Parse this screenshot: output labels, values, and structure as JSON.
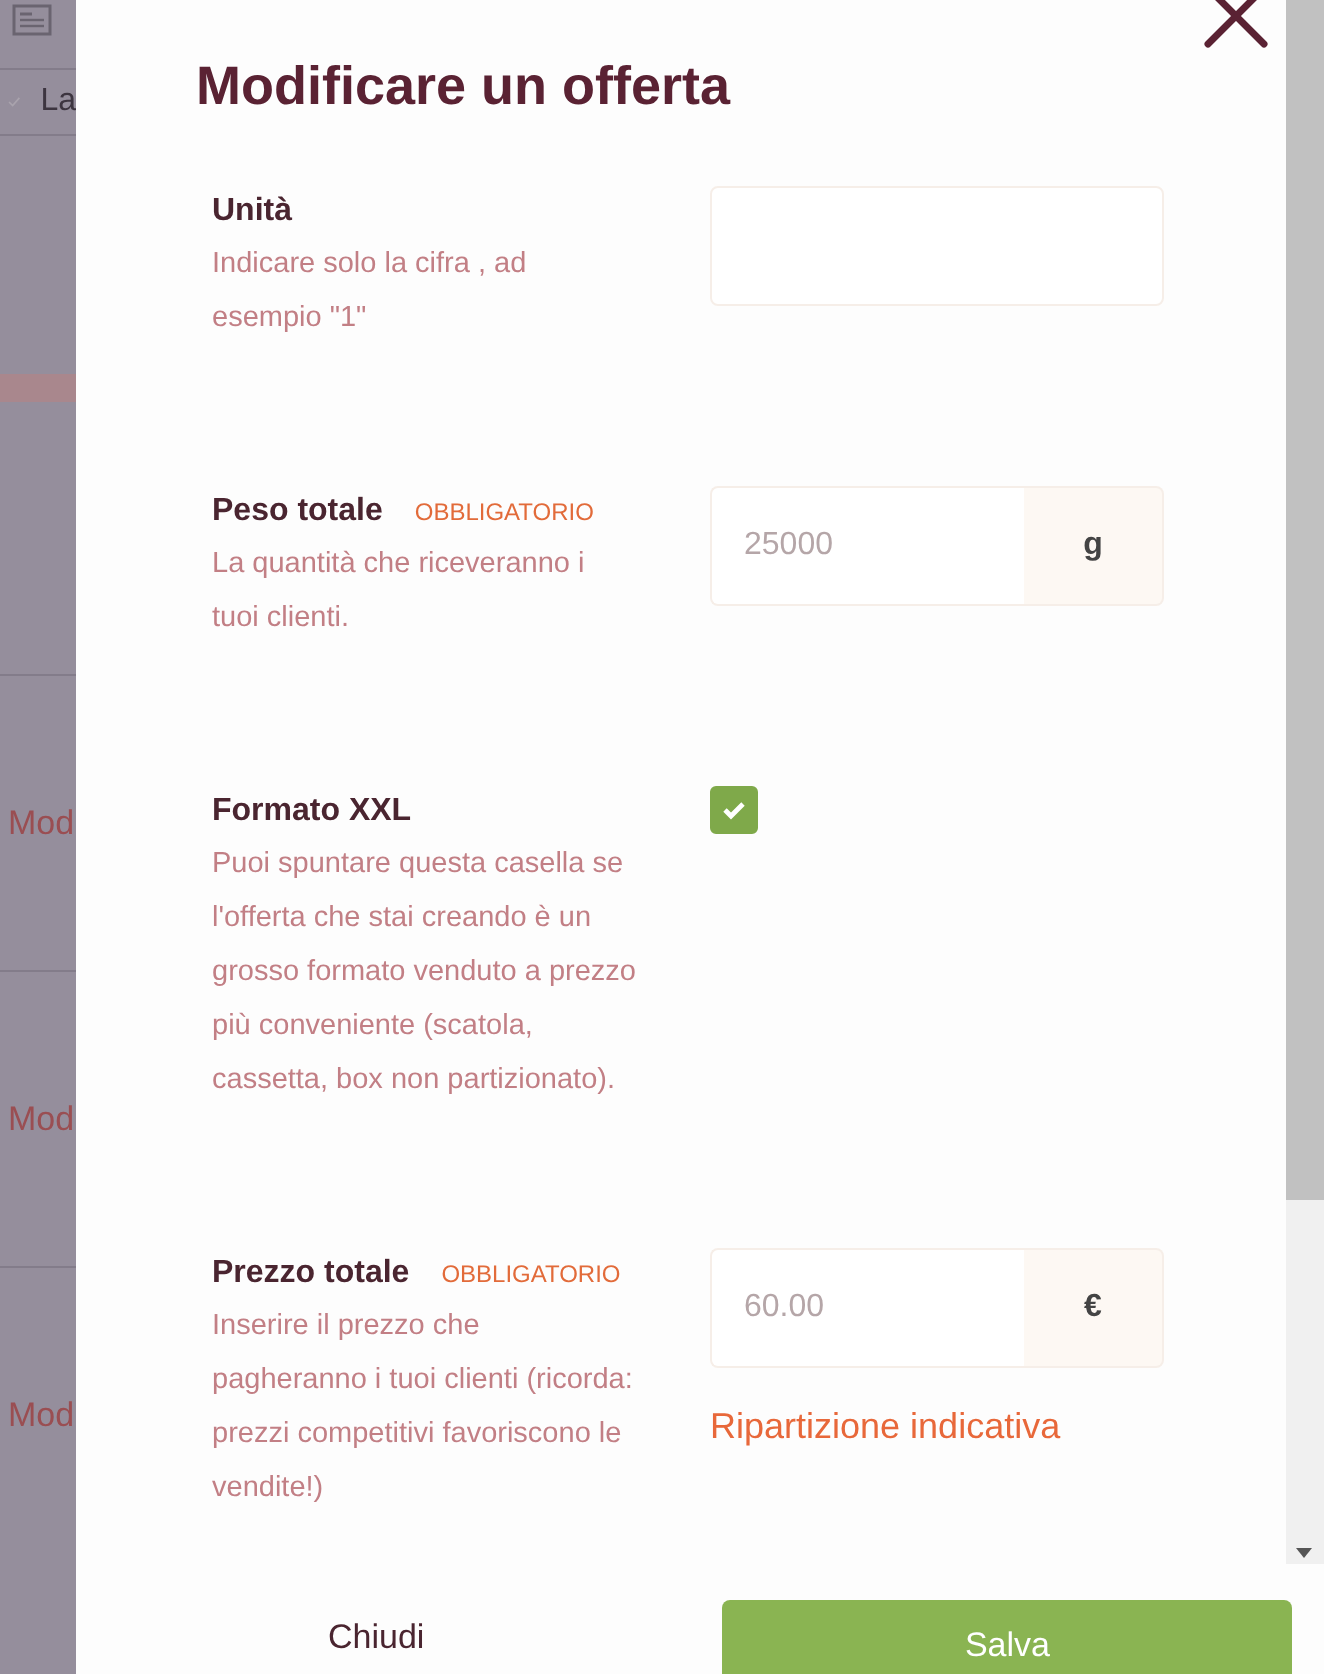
{
  "background": {
    "tab_label": "La",
    "items": [
      "Mod",
      "Mod",
      "Mod"
    ]
  },
  "dialog": {
    "title": "Modificare un offerta",
    "fields": [
      {
        "kind": "text",
        "label": "Unità",
        "description": "Indicare solo la cifra , ad esempio \"1\""
      },
      {
        "kind": "unit",
        "label": "Peso totale",
        "badge": "OBBLIGATORIO",
        "description": "La quantità che riceveranno i tuoi clienti.",
        "placeholder": "25000",
        "unit": "g"
      },
      {
        "kind": "checkbox",
        "label": "Formato XXL",
        "description": "Puoi spuntare questa casella se l'offerta che stai creando è un grosso formato venduto a prezzo più conveniente (scatola, cassetta, box non partizionato).",
        "checked": true
      },
      {
        "kind": "unit",
        "label": "Prezzo totale",
        "badge": "OBBLIGATORIO",
        "description": "Inserire il prezzo che pagheranno i tuoi clienti (ricorda: prezzi competitivi favoriscono le vendite!)",
        "placeholder": "60.00",
        "unit": "€",
        "link": "Ripartizione indicativa"
      }
    ],
    "buttons": {
      "cancel": "Chiudi",
      "save": "Salva"
    }
  }
}
